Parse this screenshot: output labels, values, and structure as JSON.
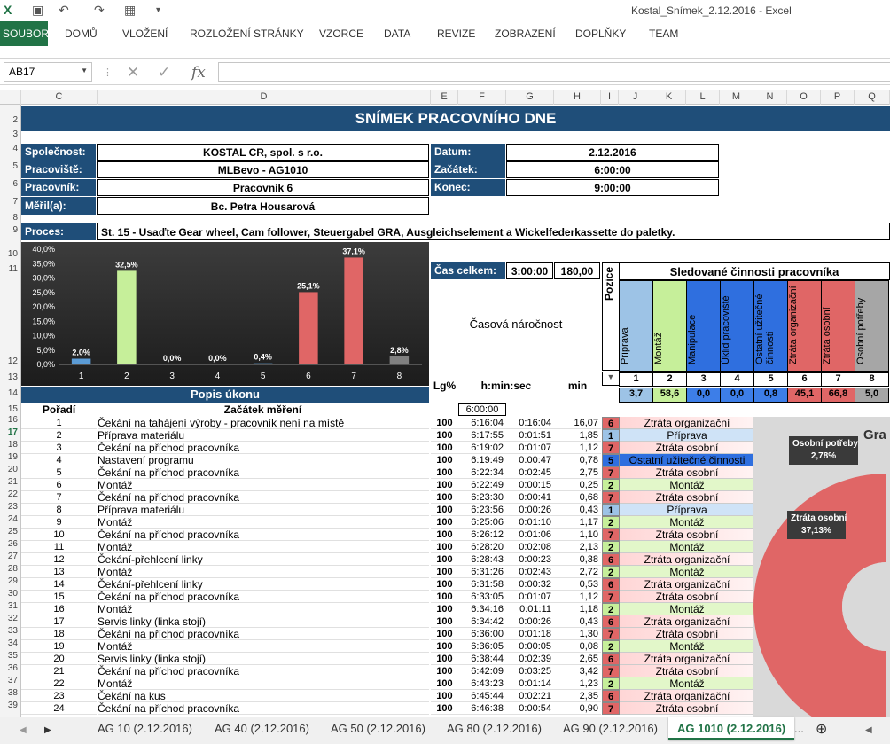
{
  "window": {
    "title": "Kostal_Snímek_2.12.2016 - Excel"
  },
  "ribbon": {
    "file_tab": "SOUBOR",
    "tabs": [
      "DOMŮ",
      "VLOŽENÍ",
      "ROZLOŽENÍ STRÁNKY",
      "VZORCE",
      "DATA",
      "REVIZE",
      "ZOBRAZENÍ",
      "DOPLŇKY",
      "TEAM"
    ]
  },
  "formula_bar": {
    "name_box": "AB17",
    "fx": "fx",
    "value": ""
  },
  "columns": [
    "C",
    "D",
    "E",
    "F",
    "G",
    "H",
    "I",
    "J",
    "K",
    "L",
    "M",
    "N",
    "O",
    "P",
    "Q"
  ],
  "rows": [
    "2",
    "3",
    "4",
    "5",
    "6",
    "7",
    "8",
    "9",
    "10",
    "11",
    "12",
    "13",
    "14",
    "15",
    "16",
    "17",
    "18",
    "19",
    "20",
    "21",
    "22",
    "23",
    "24",
    "25",
    "26",
    "27",
    "28",
    "29",
    "30",
    "31",
    "32",
    "33",
    "34",
    "35",
    "36",
    "37",
    "38",
    "39"
  ],
  "sheet": {
    "title": "SNÍMEK PRACOVNÍHO DNE",
    "company_label": "Společnost:",
    "company": "KOSTAL CR, spol. s r.o.",
    "workplace_label": "Pracoviště:",
    "workplace": "MLBevo - AG1010",
    "worker_label": "Pracovník:",
    "worker": "Pracovník 6",
    "measured_label": "Měřil(a):",
    "measured": "Bc. Petra Housarová",
    "date_label": "Datum:",
    "date": "2.12.2016",
    "start_label": "Začátek:",
    "start": "6:00:00",
    "end_label": "Konec:",
    "end": "9:00:00",
    "process_label": "Proces:",
    "process": "St. 15 - Usaďte Gear wheel, Cam follower, Steuergabel GRA, Ausgleichselement a Wickelfederkassette do paletky.",
    "total_label": "Čas celkem:",
    "total_time": "3:00:00",
    "total_min": "180,00",
    "time_demand": "Časová náročnost",
    "tracked_label": "Sledované činnosti pracovníka",
    "position_label": "Pozice",
    "op_desc": "Popis úkonu",
    "lg": "Lg%",
    "hms": "h:min:sec",
    "min": "min",
    "order_label": "Pořadí",
    "measure_start": "Začátek měření",
    "measure_start_time": "6:00:00",
    "filter_icon": "▼"
  },
  "categories": [
    {
      "num": "1",
      "name": "Příprava",
      "total": "3,7",
      "color": "#9dc3e6"
    },
    {
      "num": "2",
      "name": "Montáž",
      "total": "58,6",
      "color": "#c6ef9a"
    },
    {
      "num": "3",
      "name": "Manipulace",
      "total": "0,0",
      "color": "#2f6fdf"
    },
    {
      "num": "4",
      "name": "Úklid pracoviště",
      "total": "0,0",
      "color": "#2f6fdf"
    },
    {
      "num": "5",
      "name": "Ostatní užitečné činnosti",
      "total": "0,8",
      "color": "#2f6fdf"
    },
    {
      "num": "6",
      "name": "Ztráta organizační",
      "total": "45,1",
      "color": "#e06666"
    },
    {
      "num": "7",
      "name": "Ztráta osobní",
      "total": "66,8",
      "color": "#e06666"
    },
    {
      "num": "8",
      "name": "Osobní potřeby",
      "total": "5,0",
      "color": "#a6a6a6"
    }
  ],
  "chart_data": [
    {
      "type": "bar",
      "categories": [
        "1",
        "2",
        "3",
        "4",
        "5",
        "6",
        "7",
        "8"
      ],
      "values": [
        2.0,
        32.5,
        0.0,
        0.0,
        0.4,
        25.1,
        37.1,
        2.8
      ],
      "value_labels": [
        "2,0%",
        "32,5%",
        "0,0%",
        "0,0%",
        "0,4%",
        "25,1%",
        "37,1%",
        "2,8%"
      ],
      "yticks": [
        "40,0%",
        "35,0%",
        "30,0%",
        "25,0%",
        "20,0%",
        "15,0%",
        "10,0%",
        "5,0%",
        "0,0%"
      ],
      "ylim": [
        0,
        40
      ],
      "colors": [
        "#5b9bd5",
        "#c6ef9a",
        "#5b9bd5",
        "#5b9bd5",
        "#5b9bd5",
        "#e06666",
        "#e06666",
        "#808080"
      ],
      "title": "",
      "xlabel": "",
      "ylabel": ""
    },
    {
      "type": "pie",
      "title_partial": "Gra",
      "labels": [
        "Osobní potřeby",
        "Ztráta osobní"
      ],
      "value_labels": [
        "2,78%",
        "37,13%"
      ]
    }
  ],
  "records": [
    {
      "n": "1",
      "desc": "Čekání na tahájení výroby - pracovník není na místě",
      "lg": "100",
      "time": "6:16:04",
      "dur": "0:16:04",
      "min": "16,07",
      "pos": "6",
      "cat": "Ztráta organizační"
    },
    {
      "n": "2",
      "desc": "Příprava materiálu",
      "lg": "100",
      "time": "6:17:55",
      "dur": "0:01:51",
      "min": "1,85",
      "pos": "1",
      "cat": "Příprava"
    },
    {
      "n": "3",
      "desc": "Čekání na příchod pracovníka",
      "lg": "100",
      "time": "6:19:02",
      "dur": "0:01:07",
      "min": "1,12",
      "pos": "7",
      "cat": "Ztráta osobní"
    },
    {
      "n": "4",
      "desc": "Nastavení programu",
      "lg": "100",
      "time": "6:19:49",
      "dur": "0:00:47",
      "min": "0,78",
      "pos": "5",
      "cat": "Ostatní užitečné činnosti"
    },
    {
      "n": "5",
      "desc": "Čekání na příchod pracovníka",
      "lg": "100",
      "time": "6:22:34",
      "dur": "0:02:45",
      "min": "2,75",
      "pos": "7",
      "cat": "Ztráta osobní"
    },
    {
      "n": "6",
      "desc": "Montáž",
      "lg": "100",
      "time": "6:22:49",
      "dur": "0:00:15",
      "min": "0,25",
      "pos": "2",
      "cat": "Montáž"
    },
    {
      "n": "7",
      "desc": "Čekání na příchod pracovníka",
      "lg": "100",
      "time": "6:23:30",
      "dur": "0:00:41",
      "min": "0,68",
      "pos": "7",
      "cat": "Ztráta osobní"
    },
    {
      "n": "8",
      "desc": "Příprava materiálu",
      "lg": "100",
      "time": "6:23:56",
      "dur": "0:00:26",
      "min": "0,43",
      "pos": "1",
      "cat": "Příprava"
    },
    {
      "n": "9",
      "desc": "Montáž",
      "lg": "100",
      "time": "6:25:06",
      "dur": "0:01:10",
      "min": "1,17",
      "pos": "2",
      "cat": "Montáž"
    },
    {
      "n": "10",
      "desc": "Čekání na příchod pracovníka",
      "lg": "100",
      "time": "6:26:12",
      "dur": "0:01:06",
      "min": "1,10",
      "pos": "7",
      "cat": "Ztráta osobní"
    },
    {
      "n": "11",
      "desc": "Montáž",
      "lg": "100",
      "time": "6:28:20",
      "dur": "0:02:08",
      "min": "2,13",
      "pos": "2",
      "cat": "Montáž"
    },
    {
      "n": "12",
      "desc": "Čekání-přehlcení linky",
      "lg": "100",
      "time": "6:28:43",
      "dur": "0:00:23",
      "min": "0,38",
      "pos": "6",
      "cat": "Ztráta organizační"
    },
    {
      "n": "13",
      "desc": "Montáž",
      "lg": "100",
      "time": "6:31:26",
      "dur": "0:02:43",
      "min": "2,72",
      "pos": "2",
      "cat": "Montáž"
    },
    {
      "n": "14",
      "desc": "Čekání-přehlcení linky",
      "lg": "100",
      "time": "6:31:58",
      "dur": "0:00:32",
      "min": "0,53",
      "pos": "6",
      "cat": "Ztráta organizační"
    },
    {
      "n": "15",
      "desc": "Čekání na příchod pracovníka",
      "lg": "100",
      "time": "6:33:05",
      "dur": "0:01:07",
      "min": "1,12",
      "pos": "7",
      "cat": "Ztráta osobní"
    },
    {
      "n": "16",
      "desc": "Montáž",
      "lg": "100",
      "time": "6:34:16",
      "dur": "0:01:11",
      "min": "1,18",
      "pos": "2",
      "cat": "Montáž"
    },
    {
      "n": "17",
      "desc": "Servis linky (linka stojí)",
      "lg": "100",
      "time": "6:34:42",
      "dur": "0:00:26",
      "min": "0,43",
      "pos": "6",
      "cat": "Ztráta organizační"
    },
    {
      "n": "18",
      "desc": "Čekání na příchod pracovníka",
      "lg": "100",
      "time": "6:36:00",
      "dur": "0:01:18",
      "min": "1,30",
      "pos": "7",
      "cat": "Ztráta osobní"
    },
    {
      "n": "19",
      "desc": "Montáž",
      "lg": "100",
      "time": "6:36:05",
      "dur": "0:00:05",
      "min": "0,08",
      "pos": "2",
      "cat": "Montáž"
    },
    {
      "n": "20",
      "desc": "Servis linky (linka stojí)",
      "lg": "100",
      "time": "6:38:44",
      "dur": "0:02:39",
      "min": "2,65",
      "pos": "6",
      "cat": "Ztráta organizační"
    },
    {
      "n": "21",
      "desc": "Čekání na příchod pracovníka",
      "lg": "100",
      "time": "6:42:09",
      "dur": "0:03:25",
      "min": "3,42",
      "pos": "7",
      "cat": "Ztráta osobní"
    },
    {
      "n": "22",
      "desc": "Montáž",
      "lg": "100",
      "time": "6:43:23",
      "dur": "0:01:14",
      "min": "1,23",
      "pos": "2",
      "cat": "Montáž"
    },
    {
      "n": "23",
      "desc": "Čekání na kus",
      "lg": "100",
      "time": "6:45:44",
      "dur": "0:02:21",
      "min": "2,35",
      "pos": "6",
      "cat": "Ztráta organizační"
    },
    {
      "n": "24",
      "desc": "Čekání na příchod pracovníka",
      "lg": "100",
      "time": "6:46:38",
      "dur": "0:00:54",
      "min": "0,90",
      "pos": "7",
      "cat": "Ztráta osobní"
    }
  ],
  "pos_colors": {
    "1": "#9dc3e6",
    "2": "#c6ef9a",
    "5": "#2f6fdf",
    "6": "#e06666",
    "7": "#e06666"
  },
  "sheet_tabs": [
    "AG 10 (2.12.2016)",
    "AG 40 (2.12.2016)",
    "AG 50 (2.12.2016)",
    "AG 80 (2.12.2016)",
    "AG 90 (2.12.2016)",
    "AG 1010 (2.12.2016)"
  ],
  "sheet_tabs_more": "...",
  "add_sheet": "⊕"
}
